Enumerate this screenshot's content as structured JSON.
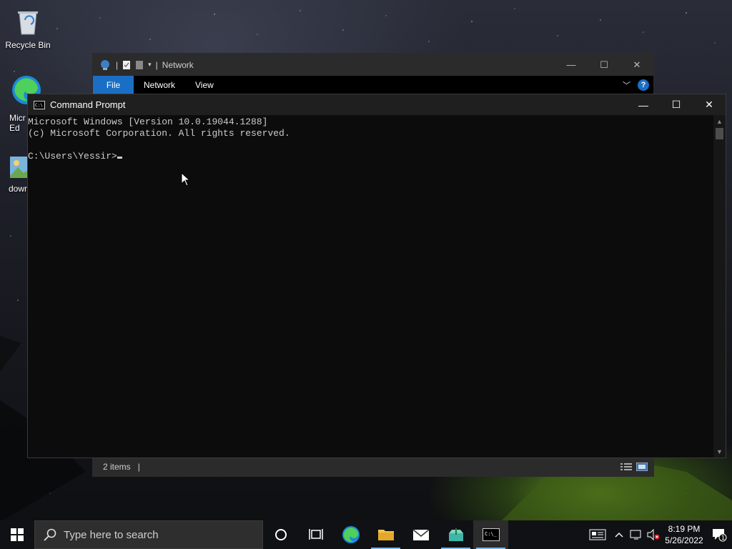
{
  "desktop": {
    "icons": [
      {
        "label": "Recycle Bin",
        "icon": "recycle-bin-icon"
      },
      {
        "label": "Micr Ed",
        "icon": "edge-icon"
      },
      {
        "label": "down",
        "icon": "image-file-icon"
      }
    ]
  },
  "explorer": {
    "title": "Network",
    "ribbon_tabs": {
      "file": "File",
      "network": "Network",
      "view": "View"
    },
    "help_label": "?",
    "status": {
      "items": "2 items",
      "separator": "|"
    },
    "controls": {
      "minimize": "—",
      "maximize": "☐",
      "close": "✕"
    }
  },
  "cmd": {
    "title": "Command Prompt",
    "lines": [
      "Microsoft Windows [Version 10.0.19044.1288]",
      "(c) Microsoft Corporation. All rights reserved.",
      "",
      "C:\\Users\\Yessir>"
    ],
    "controls": {
      "minimize": "—",
      "maximize": "☐",
      "close": "✕"
    }
  },
  "taskbar": {
    "search_placeholder": "Type here to search",
    "apps": [
      {
        "name": "Cortana",
        "icon": "cortana-circle-icon"
      },
      {
        "name": "Task View",
        "icon": "task-view-icon"
      },
      {
        "name": "Microsoft Edge",
        "icon": "edge-icon"
      },
      {
        "name": "File Explorer",
        "icon": "folder-icon"
      },
      {
        "name": "Mail",
        "icon": "mail-icon"
      },
      {
        "name": "Installer",
        "icon": "installer-box-icon"
      },
      {
        "name": "Command Prompt",
        "icon": "cmd-icon"
      }
    ],
    "clock": {
      "time": "8:19 PM",
      "date": "5/26/2022"
    },
    "notification_count": "1"
  },
  "colors": {
    "accent": "#1a6fc4",
    "taskbar_indicator": "#76b9ed",
    "console_text": "#cccccc"
  }
}
